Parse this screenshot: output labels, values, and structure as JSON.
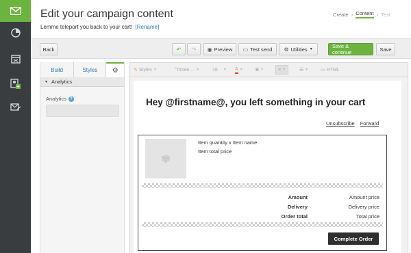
{
  "header": {
    "title": "Edit your campaign content",
    "subtitle": "Lemme teleport you back to your cart!",
    "rename_link": "[Rename]",
    "steps": [
      "Create",
      "Content",
      "Test"
    ]
  },
  "toolbar": {
    "back": "Back",
    "preview": "Preview",
    "test_send": "Test send",
    "utilities": "Utilities",
    "save_continue": "Save & continue",
    "save": "Save"
  },
  "panel": {
    "tabs": [
      "Build",
      "Styles"
    ],
    "section": "Analytics",
    "field_label": "Analytics",
    "field_value": ""
  },
  "editor_toolbar": {
    "styles": "Styles",
    "font": "\"Times ...",
    "size": "16",
    "html": "HTML"
  },
  "email": {
    "headline": "Hey @firstname@, you left something in your cart",
    "unsubscribe": "Unsubscribe",
    "forward": "Forward",
    "item_name": "Item quantity x Item name",
    "item_total": "Item total price",
    "summary": [
      {
        "label": "Amount",
        "value": "Amount price"
      },
      {
        "label": "Delivery",
        "value": "Delivery price"
      },
      {
        "label": "Order total",
        "value": "Total price"
      }
    ],
    "cta": "Complete Order"
  },
  "colors": {
    "accent": "#6cb33f",
    "rail": "#3a3d3f",
    "link": "#2b7bb9",
    "cta": "#2f2f2f"
  }
}
